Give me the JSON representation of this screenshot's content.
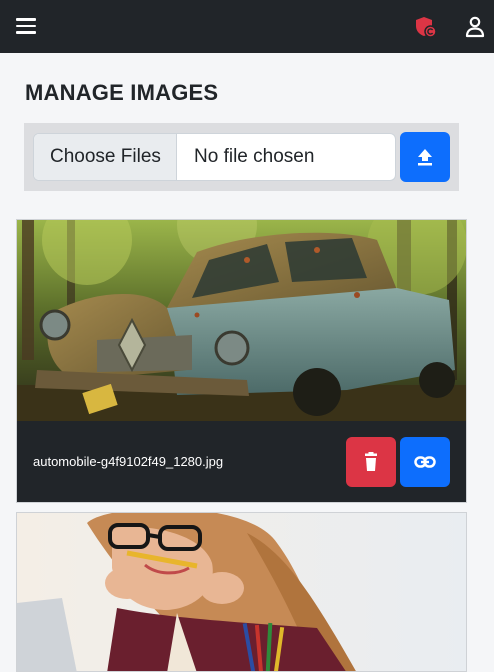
{
  "navbar": {
    "menu_icon": "hamburger-menu-icon",
    "shield_icon": "shield-icon",
    "user_icon": "user-icon",
    "bg": "#212529",
    "shield_color": "#dc3545"
  },
  "page": {
    "title": "MANAGE IMAGES"
  },
  "upload": {
    "choose_label": "Choose Files",
    "status": "No file chosen",
    "upload_icon": "upload-icon",
    "button_color": "#0d6efd"
  },
  "images": [
    {
      "filename": "automobile-g4f9102f49_1280.jpg",
      "delete_icon": "trash-icon",
      "link_icon": "link-icon"
    },
    {
      "filename": ""
    }
  ],
  "colors": {
    "primary": "#0d6efd",
    "danger": "#dc3545",
    "dark": "#212529"
  }
}
